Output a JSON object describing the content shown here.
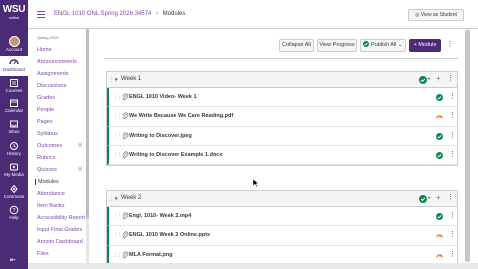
{
  "header": {
    "breadcrumb_course": "ENGL 1010 ONL Spring 2026 34574",
    "breadcrumb_sep": "›",
    "breadcrumb_page": "Modules",
    "view_as_student": "View as Student",
    "view_as_student_icon": "eye-icon"
  },
  "logo": {
    "main": "WSU",
    "sub": "online"
  },
  "global_nav": [
    {
      "label": "Account",
      "icon": "avatar"
    },
    {
      "label": "Dashboard",
      "icon": "dashboard-icon"
    },
    {
      "label": "Courses",
      "icon": "courses-icon"
    },
    {
      "label": "Calendar",
      "icon": "calendar-icon"
    },
    {
      "label": "Inbox",
      "icon": "inbox-icon"
    },
    {
      "label": "History",
      "icon": "history-icon"
    },
    {
      "label": "My Media",
      "icon": "media-icon"
    },
    {
      "label": "Commons",
      "icon": "commons-icon"
    },
    {
      "label": "Help",
      "icon": "help-icon"
    }
  ],
  "course_nav": {
    "term": "Spring 2026",
    "items": [
      "Home",
      "Announcements",
      "Assignments",
      "Discussions",
      "Grades",
      "People",
      "Pages",
      "Syllabus",
      "Outcomes",
      "Rubrics",
      "Quizzes",
      "Modules",
      "Attendance",
      "Item Banks",
      "Accessibility Report",
      "Input Final Grades",
      "Annoto Dashboard",
      "Files"
    ],
    "active": "Modules"
  },
  "toolbar": {
    "collapse_all": "Collapse All",
    "view_progress": "View Progress",
    "publish_all": "Publish All",
    "add_module": "Module",
    "add_prefix": "+"
  },
  "modules": [
    {
      "title": "Week 1",
      "items": [
        "ENGL 1010 Video- Week 1",
        "We Write Because We Care Reading.pdf",
        "Writing to Discover.jpeg",
        "Writing to Discover Example 1.docx"
      ],
      "item_status": [
        "published",
        "warning",
        "published",
        "published"
      ]
    },
    {
      "title": "Week 2",
      "items": [
        "Engl. 1010- Week 2.mp4",
        "ENGL 1010 Week 2 Online.pptx",
        "MLA Format.png"
      ],
      "item_status": [
        "published",
        "warning",
        "warning"
      ]
    }
  ],
  "colors": {
    "brand": "#4b2a76",
    "link": "#7d4aa6",
    "published": "#0b874b",
    "warning": "#fc5e13"
  }
}
